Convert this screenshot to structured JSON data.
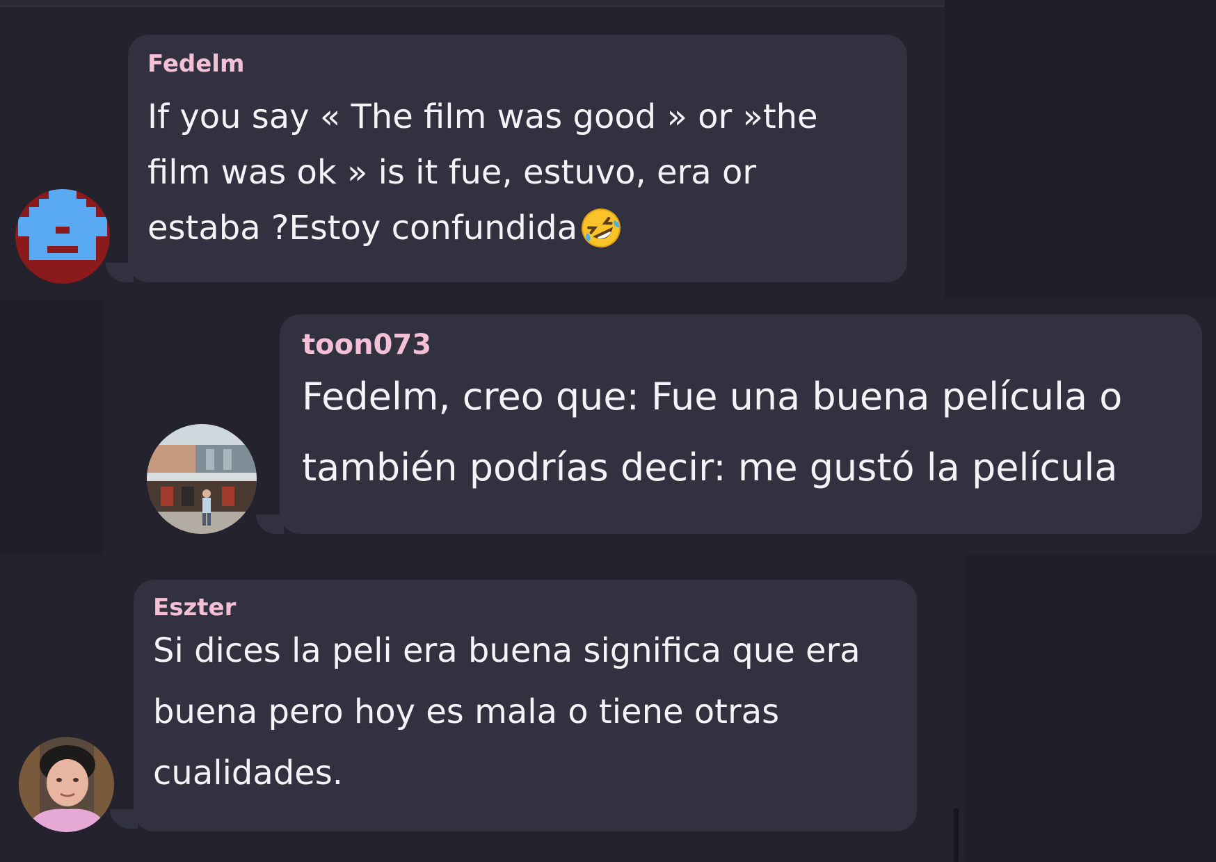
{
  "messages": [
    {
      "author": "Fedelm",
      "text": "If you say «  The film was good » or »the\nfilm was ok » is it fue, estuvo, era or\nestaba ?Estoy confundida",
      "emoji": "rolling-on-the-floor-laughing-emoji"
    },
    {
      "author": "toon073",
      "text": "Fedelm, creo que: Fue una buena película o\ntambién podrías decir: me gustó la película"
    },
    {
      "author": "Eszter",
      "text": "Si dices la peli era buena significa que era\nbuena pero hoy es mala o tiene otras\ncualidades."
    }
  ],
  "colors": {
    "background": "#23222d",
    "bubble": "#32313f",
    "username": "#f3c0d6",
    "text": "#f4f3f7"
  }
}
